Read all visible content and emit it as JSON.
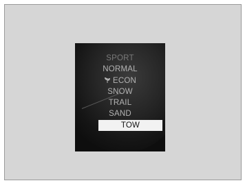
{
  "drive_mode_menu": {
    "items": [
      {
        "label": "SPORT",
        "icon": "",
        "state": "dim"
      },
      {
        "label": "NORMAL",
        "icon": "",
        "state": "normal"
      },
      {
        "label": "ECON",
        "icon": "eco-leaf-icon",
        "state": "normal"
      },
      {
        "label": "SNOW",
        "icon": "",
        "state": "normal"
      },
      {
        "label": "TRAIL",
        "icon": "",
        "state": "normal"
      },
      {
        "label": "SAND",
        "icon": "",
        "state": "normal"
      },
      {
        "label": "TOW",
        "icon": "",
        "state": "selected"
      }
    ],
    "selected": "TOW"
  },
  "colors": {
    "screen_background": "#0e0e0e",
    "item_text": "#b4b4b4",
    "selected_background": "#f2f2f2",
    "selected_text": "#111111",
    "outer_panel": "#d6d6d6"
  }
}
